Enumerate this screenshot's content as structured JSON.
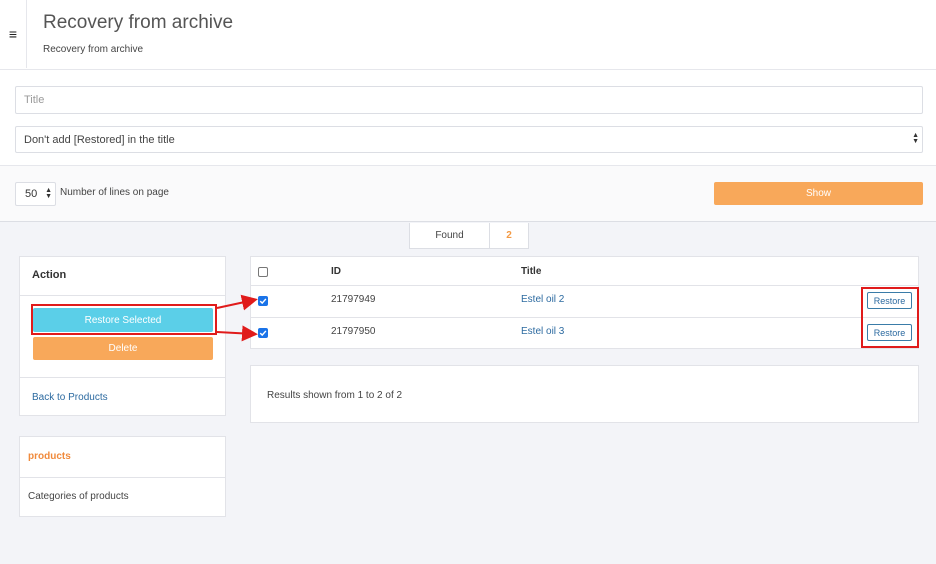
{
  "header": {
    "title": "Recovery from archive",
    "breadcrumb": "Recovery from archive",
    "menu_icon": "hamburger-icon"
  },
  "filters": {
    "title_placeholder": "Title",
    "title_value": "",
    "restored_option_selected": "Don't add [Restored] in the title"
  },
  "pagination": {
    "lines_per_page": "50",
    "lines_label": "Number of lines on page",
    "show_label": "Show"
  },
  "found": {
    "label": "Found",
    "count": "2"
  },
  "action_panel": {
    "title": "Action",
    "restore_selected_label": "Restore Selected",
    "delete_label": "Delete",
    "back_link": "Back to Products"
  },
  "category_panel": {
    "title": "products",
    "item": "Categories of products"
  },
  "table": {
    "headers": {
      "id": "ID",
      "title": "Title"
    },
    "rows": [
      {
        "checked": true,
        "id": "21797949",
        "title": "Estel oil 2",
        "action": "Restore"
      },
      {
        "checked": true,
        "id": "21797950",
        "title": "Estel oil 3",
        "action": "Restore"
      }
    ]
  },
  "results": {
    "text": "Results shown from 1 to 2 of 2"
  },
  "colors": {
    "accent_orange": "#f8a85a",
    "accent_cyan": "#5bcfe8",
    "link_blue": "#2c6aa0",
    "annotation_red": "#e01b1b",
    "checkbox_blue": "#1a73e8"
  }
}
